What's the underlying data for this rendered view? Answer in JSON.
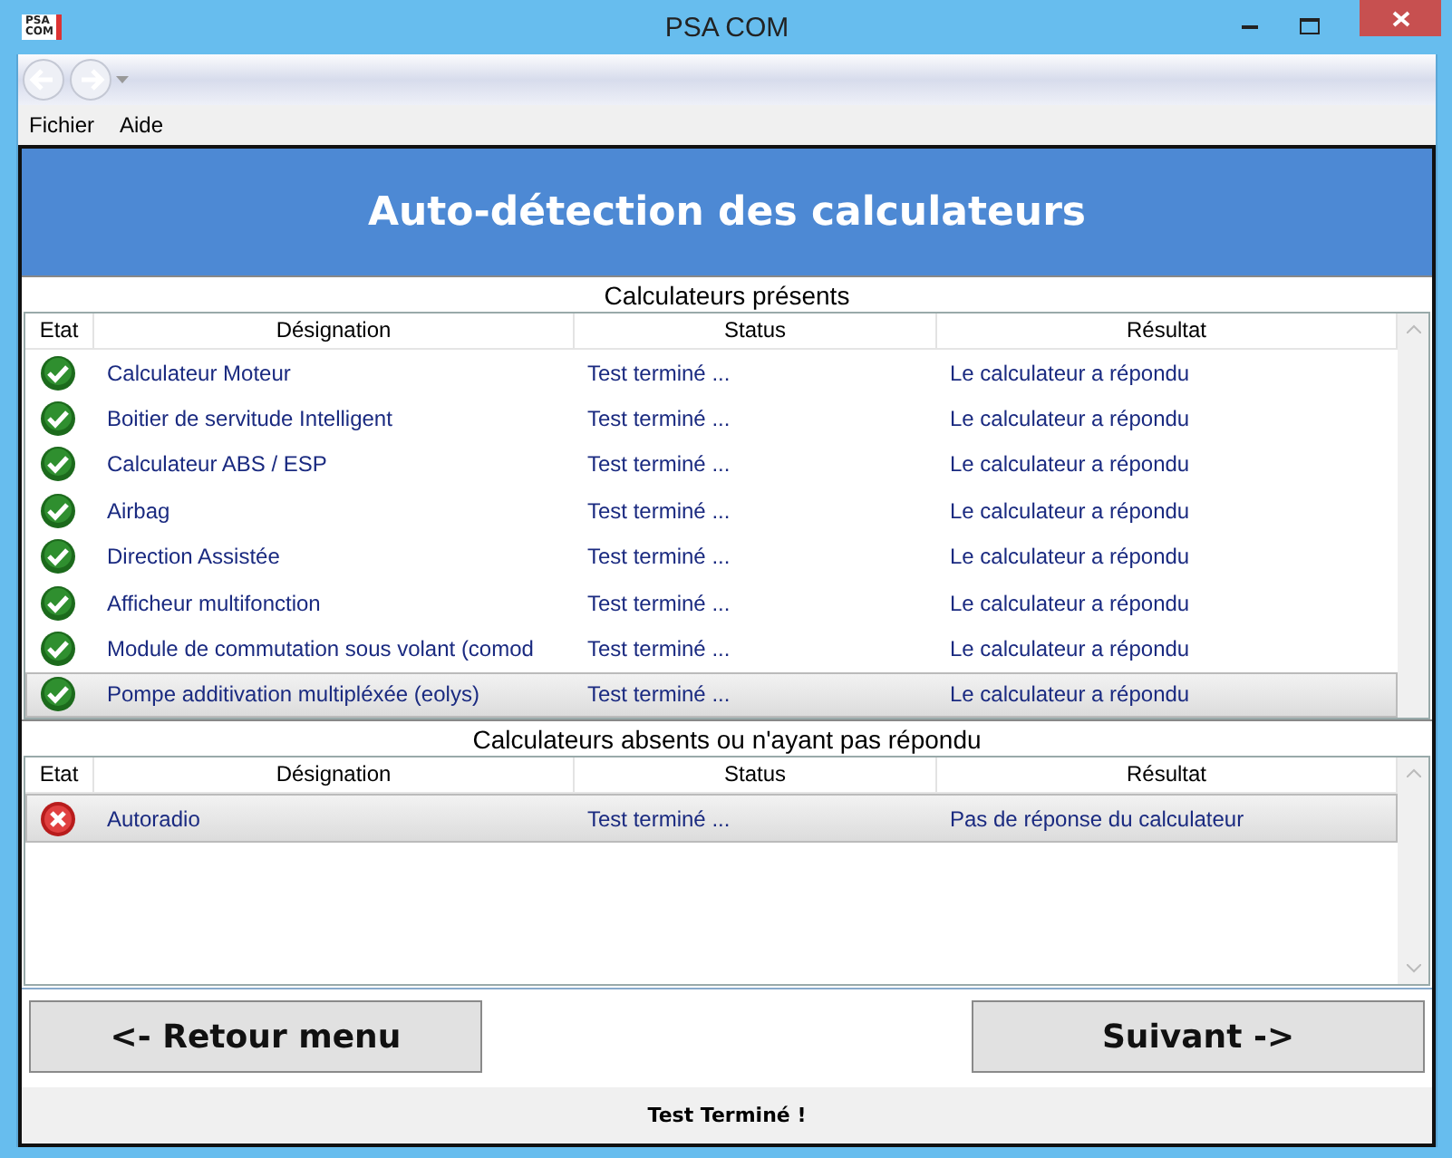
{
  "window": {
    "title": "PSA COM",
    "logo": "PSA\nCOM"
  },
  "menu": [
    "Fichier",
    "Aide"
  ],
  "header": "Auto-détection des calculateurs",
  "tables": [
    {
      "title": "Calculateurs présents",
      "columns": [
        "Etat",
        "Désignation",
        "Status",
        "Résultat"
      ],
      "rows": [
        {
          "kind": "ok",
          "designation": "Calculateur Moteur",
          "status": "Test terminé ...",
          "result": "Le calculateur a répondu",
          "selected": false
        },
        {
          "kind": "ok",
          "designation": "Boitier de servitude Intelligent",
          "status": "Test terminé ...",
          "result": "Le calculateur a répondu",
          "selected": false
        },
        {
          "kind": "ok",
          "designation": "Calculateur ABS / ESP",
          "status": "Test terminé ...",
          "result": "Le calculateur a répondu",
          "selected": false
        },
        {
          "kind": "ok",
          "designation": "Airbag",
          "status": "Test terminé ...",
          "result": "Le calculateur a répondu",
          "selected": false
        },
        {
          "kind": "ok",
          "designation": "Direction Assistée",
          "status": "Test terminé ...",
          "result": "Le calculateur a répondu",
          "selected": false
        },
        {
          "kind": "ok",
          "designation": "Afficheur multifonction",
          "status": "Test terminé ...",
          "result": "Le calculateur a répondu",
          "selected": false
        },
        {
          "kind": "ok",
          "designation": "Module de commutation sous volant (comod",
          "status": "Test terminé ...",
          "result": "Le calculateur a répondu",
          "selected": false
        },
        {
          "kind": "ok",
          "designation": "Pompe additivation multipléxée (eolys)",
          "status": "Test terminé ...",
          "result": "Le calculateur a répondu",
          "selected": true
        }
      ]
    },
    {
      "title": "Calculateurs absents ou n'ayant pas répondu",
      "columns": [
        "Etat",
        "Désignation",
        "Status",
        "Résultat"
      ],
      "rows": [
        {
          "kind": "error",
          "designation": "Autoradio",
          "status": "Test terminé ...",
          "result": "Pas de réponse du calculateur",
          "selected": true
        }
      ]
    }
  ],
  "buttons": [
    "<- Retour menu",
    "Suivant ->"
  ],
  "status_bar": "Test Terminé  !"
}
